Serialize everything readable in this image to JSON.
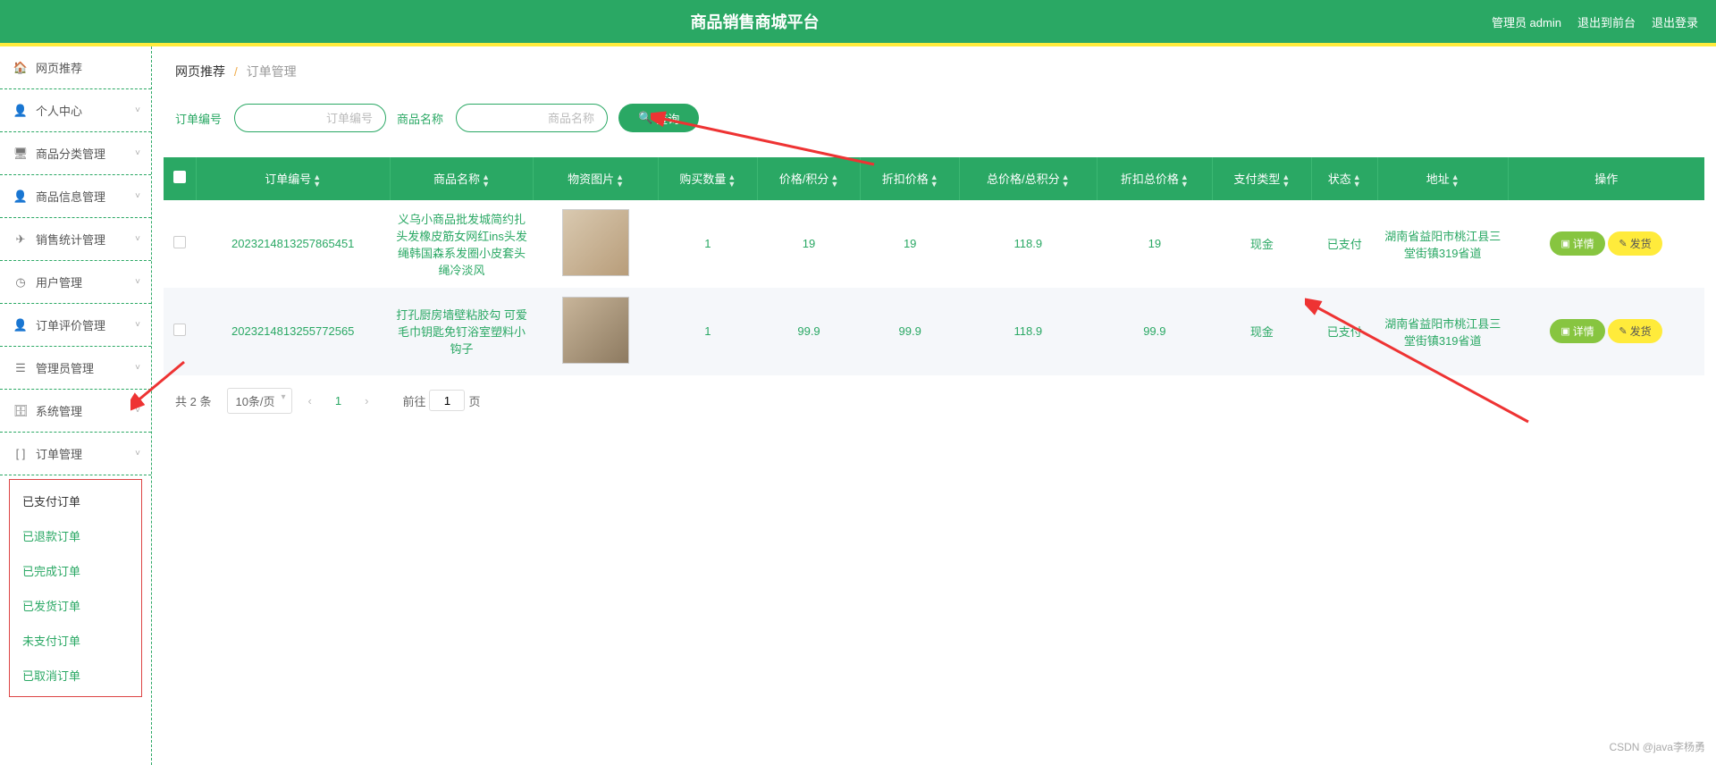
{
  "header": {
    "title": "商品销售商城平台",
    "admin": "管理员 admin",
    "to_front": "退出到前台",
    "logout": "退出登录"
  },
  "sidebar": {
    "items": [
      {
        "label": "网页推荐",
        "icon": "home"
      },
      {
        "label": "个人中心",
        "icon": "user",
        "expand": true
      },
      {
        "label": "商品分类管理",
        "icon": "monitor",
        "expand": true
      },
      {
        "label": "商品信息管理",
        "icon": "user",
        "expand": true
      },
      {
        "label": "销售统计管理",
        "icon": "send",
        "expand": true
      },
      {
        "label": "用户管理",
        "icon": "clock",
        "expand": true
      },
      {
        "label": "订单评价管理",
        "icon": "user-minus",
        "expand": true
      },
      {
        "label": "管理员管理",
        "icon": "list",
        "expand": true
      },
      {
        "label": "系统管理",
        "icon": "db",
        "expand": true
      },
      {
        "label": "订单管理",
        "icon": "brackets",
        "expand": true
      }
    ],
    "submenu": [
      "已支付订单",
      "已退款订单",
      "已完成订单",
      "已发货订单",
      "未支付订单",
      "已取消订单"
    ]
  },
  "breadcrumb": {
    "b1": "网页推荐",
    "b2": "订单管理"
  },
  "search": {
    "order_label": "订单编号",
    "order_placeholder": "订单编号",
    "name_label": "商品名称",
    "name_placeholder": "商品名称",
    "query": "查询"
  },
  "table": {
    "headers": [
      "订单编号",
      "商品名称",
      "物资图片",
      "购买数量",
      "价格/积分",
      "折扣价格",
      "总价格/总积分",
      "折扣总价格",
      "支付类型",
      "状态",
      "地址",
      "操作"
    ],
    "rows": [
      {
        "order_no": "2023214813257865451",
        "name": "义乌小商品批发城简约扎头发橡皮筋女网红ins头发绳韩国森系发圈小皮套头绳冷淡风",
        "qty": "1",
        "price": "19",
        "discount": "19",
        "total": "118.9",
        "discount_total": "19",
        "pay_type": "现金",
        "status": "已支付",
        "address": "湖南省益阳市桃江县三堂街镇319省道"
      },
      {
        "order_no": "2023214813255772565",
        "name": "打孔厨房墙壁粘胶勾 可爱毛巾钥匙免钉浴室塑料小钩子",
        "qty": "1",
        "price": "99.9",
        "discount": "99.9",
        "total": "118.9",
        "discount_total": "99.9",
        "pay_type": "现金",
        "status": "已支付",
        "address": "湖南省益阳市桃江县三堂街镇319省道"
      }
    ],
    "action_detail": "详情",
    "action_ship": "发货"
  },
  "pager": {
    "total": "共 2 条",
    "per_page": "10条/页",
    "current": "1",
    "goto_prefix": "前往",
    "goto_value": "1",
    "goto_suffix": "页"
  },
  "watermark": "CSDN @java李杨勇"
}
